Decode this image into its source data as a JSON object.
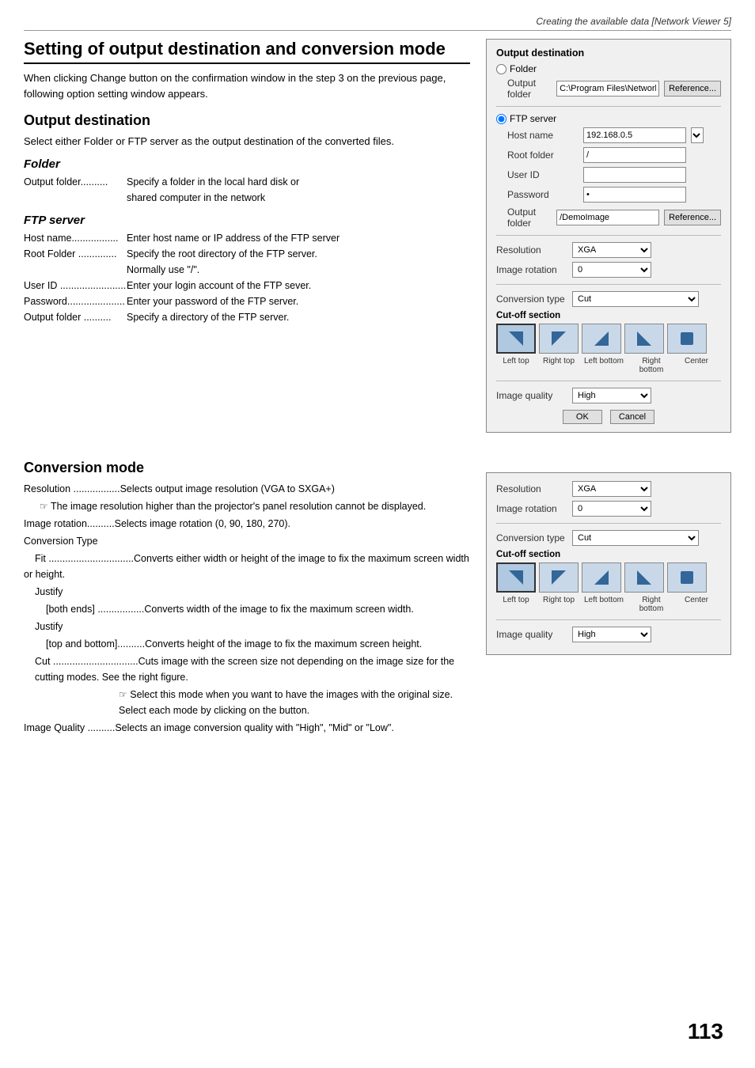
{
  "page": {
    "header": "Creating the available data [Network Viewer 5]",
    "page_number": "113"
  },
  "section1": {
    "title": "Setting of output destination and conversion mode",
    "intro": "When clicking Change button on the confirmation window in the step 3 on the previous page, following option setting window appears."
  },
  "section2": {
    "title": "Output destination",
    "desc": "Select either Folder or FTP server as the output destination of the converted files.",
    "folder": {
      "title": "Folder",
      "items": [
        {
          "label": "Output folder..........",
          "desc": "Specify a folder in the local hard disk or shared computer in the network"
        }
      ]
    },
    "ftp": {
      "title": "FTP server",
      "items": [
        {
          "label": "Host name.................",
          "desc": "Enter host name or IP address of the FTP server"
        },
        {
          "label": "Root Folder ..............",
          "desc": "Specify the root directory of the FTP server. Normally use \"/\"."
        },
        {
          "label": "User ID ........................",
          "desc": "Enter your login account of the FTP sever."
        },
        {
          "label": "Password...................",
          "desc": "Enter your password of the FTP server."
        },
        {
          "label": "Output folder ..........",
          "desc": "Specify a directory of the FTP server."
        }
      ]
    }
  },
  "panel1": {
    "title": "Output destination",
    "folder_label": "Folder",
    "folder_radio": false,
    "output_folder_label": "Output folder",
    "output_folder_value": "C:\\Program Files\\Network",
    "reference_btn": "Reference...",
    "ftp_label": "FTP server",
    "ftp_radio": true,
    "host_name_label": "Host name",
    "host_name_value": "192.168.0.5",
    "root_folder_label": "Root folder",
    "root_folder_value": "/",
    "user_id_label": "User ID",
    "user_id_value": "",
    "password_label": "Password",
    "password_value": "|",
    "output_folder2_label": "Output folder",
    "output_folder2_value": "/DemoImage",
    "reference2_btn": "Reference...",
    "resolution_label": "Resolution",
    "resolution_value": "XGA",
    "image_rotation_label": "Image rotation",
    "image_rotation_value": "0",
    "conversion_type_label": "Conversion type",
    "conversion_type_value": "Cut",
    "cut_off_section_label": "Cut-off section",
    "cut_labels": [
      "Left top",
      "Right top",
      "Left bottom",
      "Right bottom",
      "Center"
    ],
    "image_quality_label": "Image quality",
    "image_quality_value": "High",
    "ok_btn": "OK",
    "cancel_btn": "Cancel"
  },
  "section3": {
    "title": "Conversion mode",
    "items": [
      {
        "label": "Resolution .................",
        "desc": "Selects output image resolution (VGA to SXGA+)"
      },
      {
        "label": "Image rotation..........",
        "desc": "Selects image rotation (0, 90, 180, 270)."
      },
      {
        "label": "Conversion Type",
        "desc": ""
      }
    ],
    "note1": "The image resolution higher than the projector's panel resolution cannot be displayed.",
    "fit_label": "Fit ...............................",
    "fit_desc": "Converts either width or height of the image  to fix the maximum screen width or height.",
    "justify_label": "Justify",
    "justify_both_label": "[both ends] .................",
    "justify_both_desc": "Converts width of the image to fix the maximum screen width.",
    "justify2_label": "Justify",
    "justify_topbottom_label": "[top and bottom]..........",
    "justify_topbottom_desc": "Converts height of the image to fix the maximum screen height.",
    "cut_label": "Cut ...............................",
    "cut_desc": "Cuts image with the screen size not depending on the image size for the cutting modes. See the right figure.",
    "note2": "Select this mode when you want to have the images with the original size. Select each mode by clicking on the button.",
    "image_quality_label": "Image Quality ..........",
    "image_quality_desc": "Selects an image conversion quality with \"High\", \"Mid\" or \"Low\"."
  },
  "panel2": {
    "resolution_label": "Resolution",
    "resolution_value": "XGA",
    "image_rotation_label": "Image rotation",
    "image_rotation_value": "0",
    "conversion_type_label": "Conversion type",
    "conversion_type_value": "Cut",
    "cut_off_section_label": "Cut-off section",
    "cut_labels": [
      "Left top",
      "Right top",
      "Left bottom",
      "Right bottom",
      "Center"
    ],
    "image_quality_label": "Image quality",
    "image_quality_value": "High"
  }
}
